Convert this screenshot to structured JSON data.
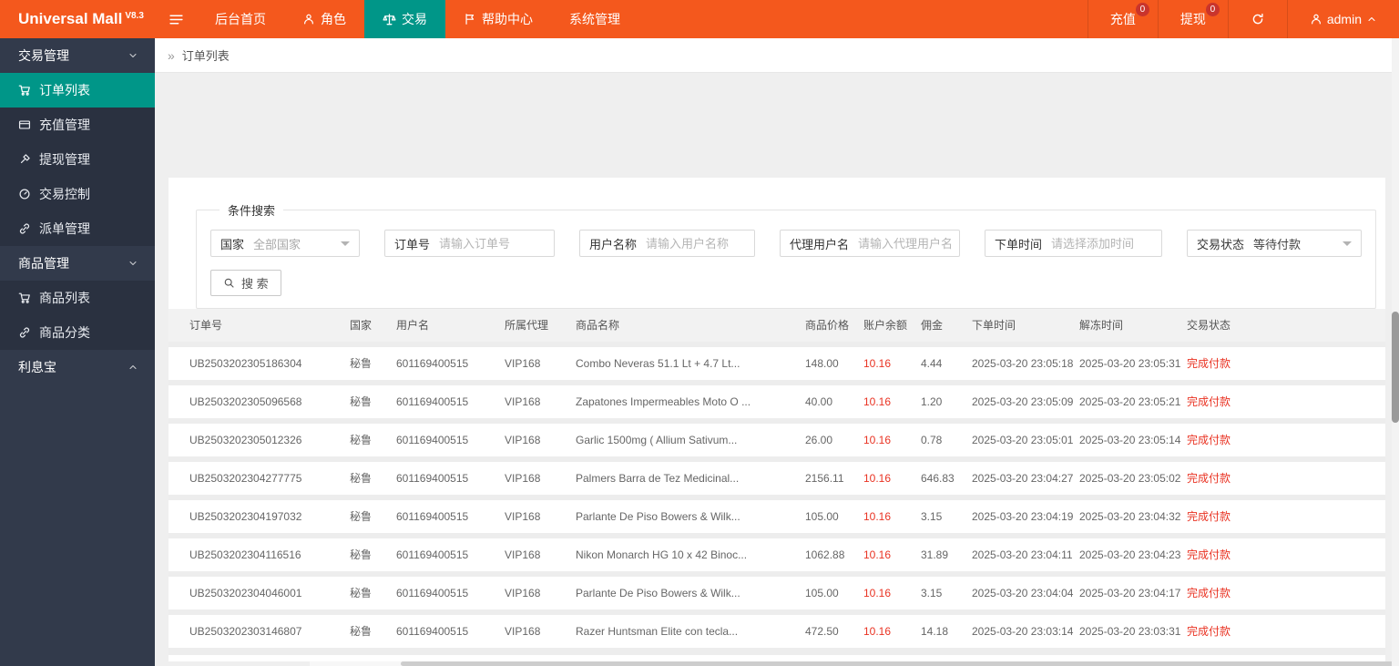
{
  "colors": {
    "header_orange": "#f4581d",
    "accent_teal": "#009688",
    "sidebar_dark": "#323a4b",
    "sidebar_child_dark": "#2a3140",
    "danger_red": "#e93323",
    "badge_red": "#c9342c"
  },
  "brand": {
    "name": "Universal Mall",
    "version": "V8.3"
  },
  "topnav": {
    "items": [
      {
        "name": "home",
        "label": "后台首页",
        "icon": null,
        "active": false
      },
      {
        "name": "roles",
        "label": "角色",
        "icon": "user",
        "active": false
      },
      {
        "name": "trade",
        "label": "交易",
        "icon": "scale",
        "active": true
      },
      {
        "name": "help-center",
        "label": "帮助中心",
        "icon": "flag",
        "active": false
      },
      {
        "name": "system",
        "label": "系统管理",
        "icon": null,
        "active": false
      }
    ]
  },
  "topbar_right": {
    "recharge": {
      "label": "充值",
      "badge": "0"
    },
    "withdraw": {
      "label": "提现",
      "badge": "0"
    },
    "user": {
      "name": "admin"
    }
  },
  "sidebar": {
    "sections": [
      {
        "name": "trade-management",
        "label": "交易管理",
        "expanded": true,
        "children": [
          {
            "name": "order-list",
            "label": "订单列表",
            "icon": "cart",
            "active": true
          },
          {
            "name": "recharge-management",
            "label": "充值管理",
            "icon": "card",
            "active": false
          },
          {
            "name": "withdraw-management",
            "label": "提现管理",
            "icon": "gavel",
            "active": false
          },
          {
            "name": "trade-control",
            "label": "交易控制",
            "icon": "control",
            "active": false
          },
          {
            "name": "dispatch-management",
            "label": "派单管理",
            "icon": "link",
            "active": false
          }
        ]
      },
      {
        "name": "product-management",
        "label": "商品管理",
        "expanded": true,
        "children": [
          {
            "name": "product-list",
            "label": "商品列表",
            "icon": "cart",
            "active": false
          },
          {
            "name": "product-category",
            "label": "商品分类",
            "icon": "link",
            "active": false
          }
        ]
      },
      {
        "name": "interest-treasure",
        "label": "利息宝",
        "expanded": false,
        "children": []
      }
    ]
  },
  "breadcrumb": {
    "prefix": "»",
    "title": "订单列表"
  },
  "search_panel": {
    "legend": "条件搜索",
    "fields": [
      {
        "name": "country",
        "label": "国家",
        "type": "select",
        "value": "全部国家",
        "muted": true
      },
      {
        "name": "order-no",
        "label": "订单号",
        "type": "input",
        "placeholder": "请输入订单号"
      },
      {
        "name": "user-name",
        "label": "用户名称",
        "type": "input",
        "placeholder": "请输入用户名称"
      },
      {
        "name": "agent-name",
        "label": "代理用户名",
        "type": "input",
        "placeholder": "请输入代理用户名"
      },
      {
        "name": "order-time",
        "label": "下单时间",
        "type": "input",
        "placeholder": "请选择添加时间"
      },
      {
        "name": "trade-status",
        "label": "交易状态",
        "type": "select",
        "value": "等待付款",
        "muted": false
      }
    ],
    "search_button": "搜 索"
  },
  "orders_table": {
    "columns": [
      "订单号",
      "国家",
      "用户名",
      "所属代理",
      "商品名称",
      "商品价格",
      "账户余额",
      "佣金",
      "下单时间",
      "解冻时间",
      "交易状态"
    ],
    "red_columns": [
      6,
      10
    ],
    "rows": [
      [
        "UB2503202305186304",
        "秘鲁",
        "601169400515",
        "VIP168",
        "Combo Neveras 51.1 Lt + 4.7 Lt...",
        "148.00",
        "10.16",
        "4.44",
        "2025-03-20 23:05:18",
        "2025-03-20 23:05:31",
        "完成付款"
      ],
      [
        "UB2503202305096568",
        "秘鲁",
        "601169400515",
        "VIP168",
        "Zapatones Impermeables Moto O ...",
        "40.00",
        "10.16",
        "1.20",
        "2025-03-20 23:05:09",
        "2025-03-20 23:05:21",
        "完成付款"
      ],
      [
        "UB2503202305012326",
        "秘鲁",
        "601169400515",
        "VIP168",
        "Garlic 1500mg ( Allium Sativum...",
        "26.00",
        "10.16",
        "0.78",
        "2025-03-20 23:05:01",
        "2025-03-20 23:05:14",
        "完成付款"
      ],
      [
        "UB2503202304277775",
        "秘鲁",
        "601169400515",
        "VIP168",
        "Palmers Barra de Tez Medicinal...",
        "2156.11",
        "10.16",
        "646.83",
        "2025-03-20 23:04:27",
        "2025-03-20 23:05:02",
        "完成付款"
      ],
      [
        "UB2503202304197032",
        "秘鲁",
        "601169400515",
        "VIP168",
        "Parlante De Piso Bowers & Wilk...",
        "105.00",
        "10.16",
        "3.15",
        "2025-03-20 23:04:19",
        "2025-03-20 23:04:32",
        "完成付款"
      ],
      [
        "UB2503202304116516",
        "秘鲁",
        "601169400515",
        "VIP168",
        "Nikon Monarch HG 10 x 42 Binoc...",
        "1062.88",
        "10.16",
        "31.89",
        "2025-03-20 23:04:11",
        "2025-03-20 23:04:23",
        "完成付款"
      ],
      [
        "UB2503202304046001",
        "秘鲁",
        "601169400515",
        "VIP168",
        "Parlante De Piso Bowers & Wilk...",
        "105.00",
        "10.16",
        "3.15",
        "2025-03-20 23:04:04",
        "2025-03-20 23:04:17",
        "完成付款"
      ],
      [
        "UB2503202303146807",
        "秘鲁",
        "601169400515",
        "VIP168",
        "Razer Huntsman Elite con tecla...",
        "472.50",
        "10.16",
        "14.18",
        "2025-03-20 23:03:14",
        "2025-03-20 23:03:31",
        "完成付款"
      ]
    ]
  }
}
